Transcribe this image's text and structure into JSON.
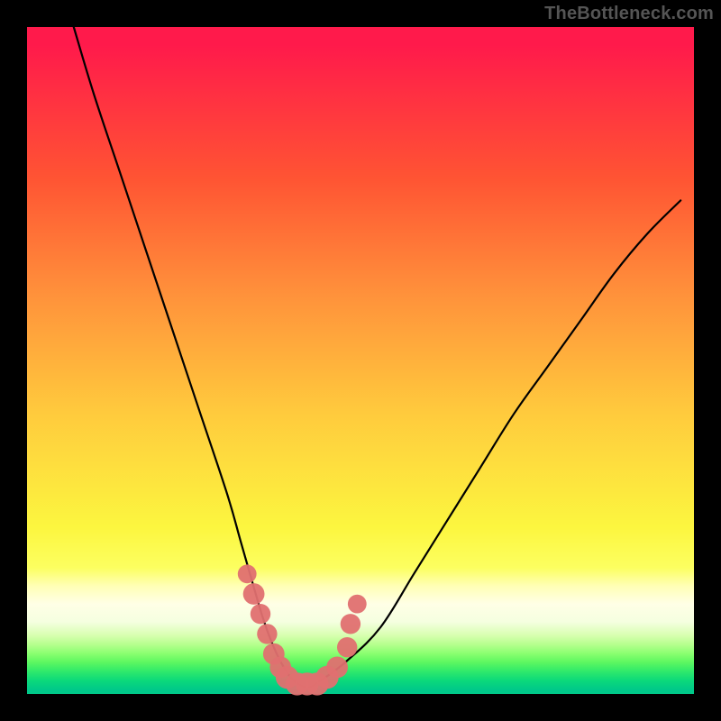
{
  "attribution": "TheBottleneck.com",
  "chart_data": {
    "type": "line",
    "title": "",
    "xlabel": "",
    "ylabel": "",
    "xlim": [
      0,
      100
    ],
    "ylim": [
      0,
      100
    ],
    "grid": false,
    "legend": false,
    "curve": {
      "x": [
        7,
        10,
        14,
        18,
        22,
        26,
        30,
        32,
        34,
        35.5,
        37,
        38.5,
        40,
        42,
        44,
        48,
        53,
        58,
        63,
        68,
        73,
        78,
        83,
        88,
        93,
        98
      ],
      "y": [
        100,
        90,
        78,
        66,
        54,
        42,
        30,
        23,
        16,
        11,
        7,
        4,
        2,
        1,
        2,
        5,
        10,
        18,
        26,
        34,
        42,
        49,
        56,
        63,
        69,
        74
      ]
    },
    "marker_cluster": {
      "type": "scatter",
      "color": "#e07070",
      "points": [
        {
          "x": 33.0,
          "y": 18.0,
          "r": 1.2
        },
        {
          "x": 34.0,
          "y": 15.0,
          "r": 1.6
        },
        {
          "x": 35.0,
          "y": 12.0,
          "r": 1.4
        },
        {
          "x": 36.0,
          "y": 9.0,
          "r": 1.4
        },
        {
          "x": 37.0,
          "y": 6.0,
          "r": 1.6
        },
        {
          "x": 38.0,
          "y": 4.0,
          "r": 1.6
        },
        {
          "x": 39.0,
          "y": 2.5,
          "r": 1.8
        },
        {
          "x": 40.5,
          "y": 1.5,
          "r": 1.8
        },
        {
          "x": 42.0,
          "y": 1.5,
          "r": 1.8
        },
        {
          "x": 43.5,
          "y": 1.5,
          "r": 1.8
        },
        {
          "x": 45.0,
          "y": 2.5,
          "r": 1.8
        },
        {
          "x": 46.5,
          "y": 4.0,
          "r": 1.6
        },
        {
          "x": 48.0,
          "y": 7.0,
          "r": 1.4
        },
        {
          "x": 48.5,
          "y": 10.5,
          "r": 1.4
        },
        {
          "x": 49.5,
          "y": 13.5,
          "r": 1.2
        }
      ]
    }
  }
}
